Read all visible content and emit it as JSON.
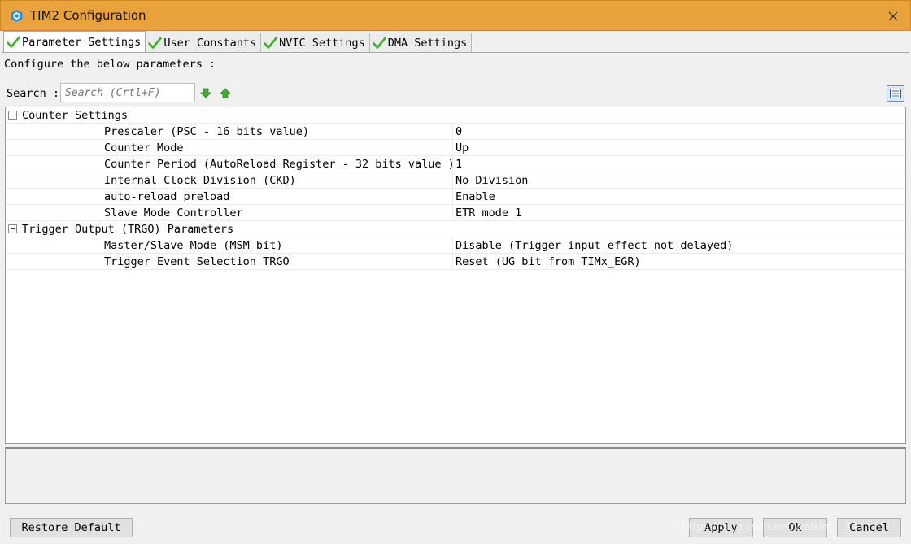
{
  "window": {
    "title": "TIM2 Configuration"
  },
  "tabs": [
    {
      "label": "Parameter Settings"
    },
    {
      "label": "User Constants"
    },
    {
      "label": "NVIC Settings"
    },
    {
      "label": "DMA Settings"
    }
  ],
  "panel": {
    "configure_text": "Configure the below parameters :",
    "search_label": "Search :",
    "search_placeholder": "Search (Crtl+F)"
  },
  "tree": {
    "counter_settings": {
      "label": "Counter Settings",
      "rows": [
        {
          "name": "Prescaler (PSC - 16 bits value)",
          "value": "0"
        },
        {
          "name": "Counter Mode",
          "value": "Up"
        },
        {
          "name": "Counter Period (AutoReload Register - 32 bits value )",
          "value": "1"
        },
        {
          "name": "Internal Clock Division (CKD)",
          "value": "No Division"
        },
        {
          "name": "auto-reload preload",
          "value": "Enable"
        },
        {
          "name": "Slave Mode Controller",
          "value": "ETR mode 1"
        }
      ]
    },
    "trgo": {
      "label": "Trigger Output (TRGO) Parameters",
      "rows": [
        {
          "name": "Master/Slave Mode (MSM bit)",
          "value": "Disable (Trigger input effect not delayed)"
        },
        {
          "name": "Trigger Event Selection TRGO",
          "value": "Reset (UG bit from TIMx_EGR)"
        }
      ]
    }
  },
  "buttons": {
    "restore": "Restore Default",
    "apply": "Apply",
    "ok": "Ok",
    "cancel": "Cancel"
  },
  "watermark": "https://blog.csdn.net/weixin_...34",
  "colors": {
    "titlebar": "#e8a33c",
    "check": "#3fae2a",
    "arrow": "#3fae2a"
  }
}
